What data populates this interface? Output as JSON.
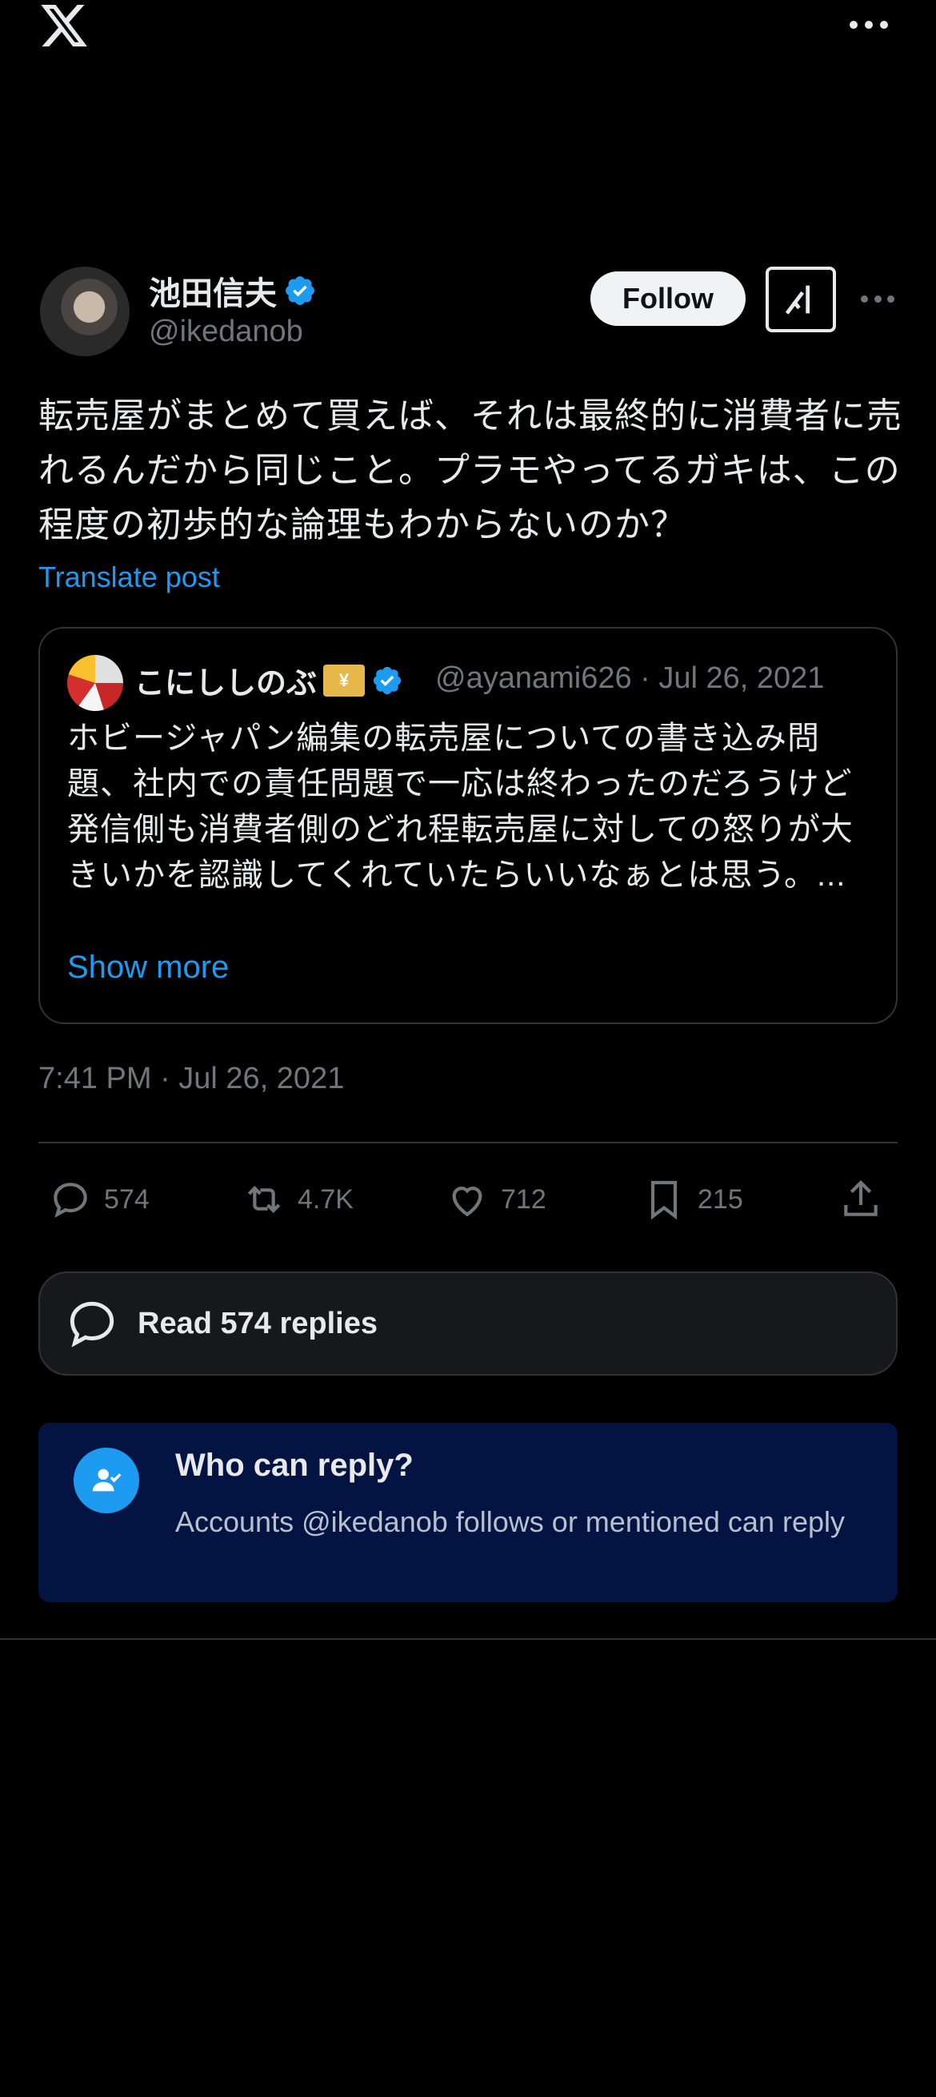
{
  "header": {
    "logo_icon": "x-logo-icon",
    "more_icon": "more-horizontal-icon"
  },
  "post": {
    "author_name": "池田信夫",
    "author_handle": "@ikedanob",
    "follow_label": "Follow",
    "text": "転売屋がまとめて買えば、それは最終的に消費者に売れるんだから同じこと。プラモやってるガキは、この程度の初歩的な論理もわからないのか？",
    "translate_label": "Translate post",
    "timestamp": "7:41 PM · Jul 26, 2021"
  },
  "quote": {
    "name": "こにししのぶ",
    "handle_meta": "@ayanami626 · Jul 26, 2021",
    "text": "ホビージャパン編集の転売屋についての書き込み問題、社内での責任問題で一応は終わったのだろうけど発信側も消費者側のどれ程転売屋に対しての怒りが大きいかを認識してくれていたらいいなぁとは思う。...",
    "show_more": "Show more",
    "emoji_label": "¥"
  },
  "actions": {
    "replies": "574",
    "reposts": "4.7K",
    "likes": "712",
    "bookmarks": "215"
  },
  "read_replies": {
    "label": "Read 574 replies"
  },
  "who_can_reply": {
    "title": "Who can reply?",
    "description": "Accounts @ikedanob follows or mentioned can reply"
  },
  "colors": {
    "accent": "#1d9bf0",
    "background": "#000000",
    "notice_bg": "#031442"
  }
}
